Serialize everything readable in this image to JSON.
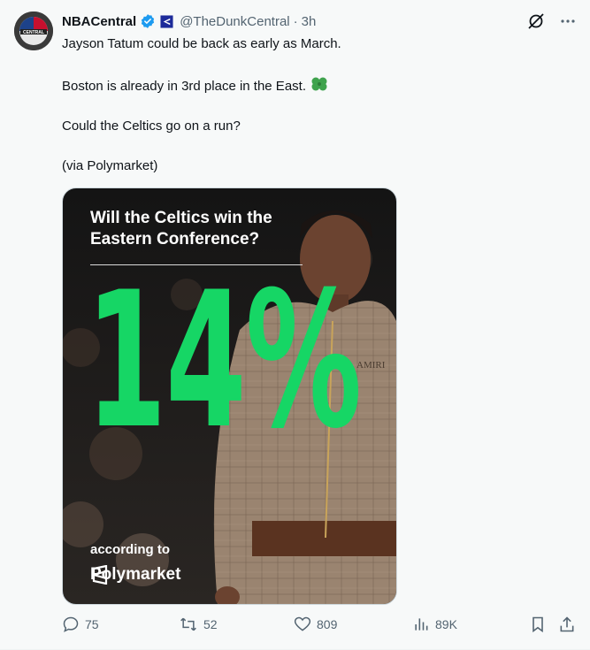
{
  "author": {
    "display_name": "NBACentral",
    "handle": "@TheDunkCentral",
    "separator": "·",
    "time": "3h",
    "verified_color": "#1d9bf0",
    "avatar_icon": "nba-central-logo-icon",
    "affiliate_icon": "affiliate-badge-icon"
  },
  "tweet": {
    "paragraphs": [
      "Jayson Tatum could be back as early as March.",
      "Boston is already in 3rd place in the East.",
      "Could the Celtics go on a run?",
      "(via Polymarket)"
    ],
    "emoji_icon": "shamrock-icon"
  },
  "media": {
    "headline": "Will the Celtics win the Eastern Conference?",
    "number": "14%",
    "according": "according to",
    "brand": "Polymarket",
    "accent_color": "#16d665",
    "jacket_text": "AMIRI"
  },
  "actions": {
    "reply_count": "75",
    "repost_count": "52",
    "like_count": "809",
    "views_count": "89K"
  },
  "colors": {
    "background": "#f7f9f9",
    "text": "#0f1419",
    "muted": "#536471"
  }
}
